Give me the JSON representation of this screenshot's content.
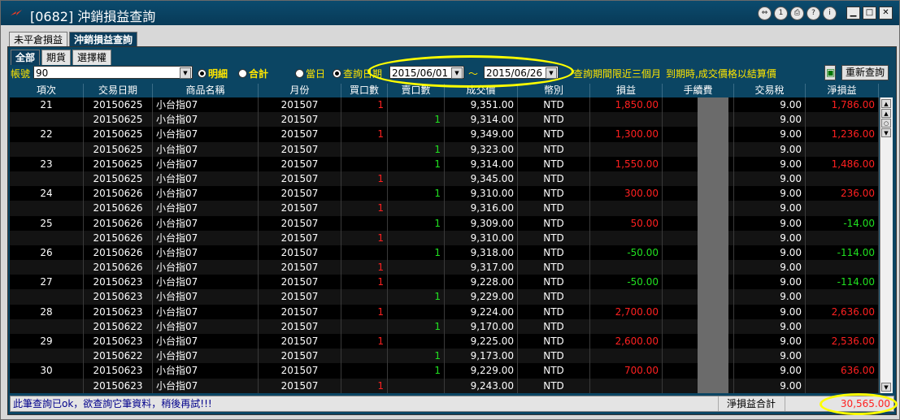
{
  "window": {
    "title": "[0682] 沖銷損益查詢"
  },
  "title_buttons": [
    "⇔",
    "1",
    "⎙",
    "?",
    "i"
  ],
  "tabs_top": [
    {
      "label": "未平倉損益",
      "active": false
    },
    {
      "label": "沖銷損益查詢",
      "active": true
    }
  ],
  "tabs_sub": [
    {
      "label": "全部",
      "active": true
    },
    {
      "label": "期貨",
      "active": false
    },
    {
      "label": "選擇權",
      "active": false
    }
  ],
  "toolbar": {
    "account_label": "帳號",
    "account_value": "90",
    "detail_label": "明細",
    "total_label": "合計",
    "today_label": "當日",
    "query_date_label": "查詢日期",
    "date_from": "2015/06/01",
    "tilde": "～",
    "date_to": "2015/06/26",
    "note1": "查詢期間限近三個月",
    "note2": "到期時,成交價格以結算價",
    "export_icon": "export-icon",
    "requery_button": "重新查詢"
  },
  "columns": [
    "項次",
    "交易日期",
    "商品名稱",
    "月份",
    "買口數",
    "賣口數",
    "成交價",
    "幣別",
    "損益",
    "手續費",
    "交易稅",
    "淨損益"
  ],
  "rows": [
    [
      "21",
      "20150625",
      "小台指07",
      "201507",
      "1",
      "",
      "9,351.00",
      "NTD",
      "1,850.00",
      "",
      "9.00",
      "1,786.00"
    ],
    [
      "",
      "20150625",
      "小台指07",
      "201507",
      "",
      "1",
      "9,314.00",
      "NTD",
      "",
      "",
      "9.00",
      ""
    ],
    [
      "22",
      "20150625",
      "小台指07",
      "201507",
      "1",
      "",
      "9,349.00",
      "NTD",
      "1,300.00",
      "",
      "9.00",
      "1,236.00"
    ],
    [
      "",
      "20150625",
      "小台指07",
      "201507",
      "",
      "1",
      "9,323.00",
      "NTD",
      "",
      "",
      "9.00",
      ""
    ],
    [
      "23",
      "20150625",
      "小台指07",
      "201507",
      "",
      "1",
      "9,314.00",
      "NTD",
      "1,550.00",
      "",
      "9.00",
      "1,486.00"
    ],
    [
      "",
      "20150625",
      "小台指07",
      "201507",
      "1",
      "",
      "9,345.00",
      "NTD",
      "",
      "",
      "9.00",
      ""
    ],
    [
      "24",
      "20150626",
      "小台指07",
      "201507",
      "",
      "1",
      "9,310.00",
      "NTD",
      "300.00",
      "",
      "9.00",
      "236.00"
    ],
    [
      "",
      "20150626",
      "小台指07",
      "201507",
      "1",
      "",
      "9,316.00",
      "NTD",
      "",
      "",
      "9.00",
      ""
    ],
    [
      "25",
      "20150626",
      "小台指07",
      "201507",
      "",
      "1",
      "9,309.00",
      "NTD",
      "50.00",
      "",
      "9.00",
      "-14.00"
    ],
    [
      "",
      "20150626",
      "小台指07",
      "201507",
      "1",
      "",
      "9,310.00",
      "NTD",
      "",
      "",
      "9.00",
      ""
    ],
    [
      "26",
      "20150626",
      "小台指07",
      "201507",
      "",
      "1",
      "9,318.00",
      "NTD",
      "-50.00",
      "",
      "9.00",
      "-114.00"
    ],
    [
      "",
      "20150626",
      "小台指07",
      "201507",
      "1",
      "",
      "9,317.00",
      "NTD",
      "",
      "",
      "9.00",
      ""
    ],
    [
      "27",
      "20150623",
      "小台指07",
      "201507",
      "1",
      "",
      "9,228.00",
      "NTD",
      "-50.00",
      "",
      "9.00",
      "-114.00"
    ],
    [
      "",
      "20150623",
      "小台指07",
      "201507",
      "",
      "1",
      "9,229.00",
      "NTD",
      "",
      "",
      "9.00",
      ""
    ],
    [
      "28",
      "20150623",
      "小台指07",
      "201507",
      "1",
      "",
      "9,224.00",
      "NTD",
      "2,700.00",
      "",
      "9.00",
      "2,636.00"
    ],
    [
      "",
      "20150622",
      "小台指07",
      "201507",
      "",
      "1",
      "9,170.00",
      "NTD",
      "",
      "",
      "9.00",
      ""
    ],
    [
      "29",
      "20150623",
      "小台指07",
      "201507",
      "1",
      "",
      "9,225.00",
      "NTD",
      "2,600.00",
      "",
      "9.00",
      "2,536.00"
    ],
    [
      "",
      "20150622",
      "小台指07",
      "201507",
      "",
      "1",
      "9,173.00",
      "NTD",
      "",
      "",
      "9.00",
      ""
    ],
    [
      "30",
      "20150623",
      "小台指07",
      "201507",
      "",
      "1",
      "9,229.00",
      "NTD",
      "700.00",
      "",
      "9.00",
      "636.00"
    ],
    [
      "",
      "20150623",
      "小台指07",
      "201507",
      "1",
      "",
      "9,243.00",
      "NTD",
      "",
      "",
      "9.00",
      ""
    ]
  ],
  "colors": {
    "buy": "#ff2020",
    "sell": "#20e020",
    "highlight": "#ffff00"
  },
  "status": {
    "message": "此筆查詢已ok，欲查詢它筆資料，稍後再試!!!",
    "total_label": "淨損益合計",
    "total_value": "30,565.00"
  }
}
